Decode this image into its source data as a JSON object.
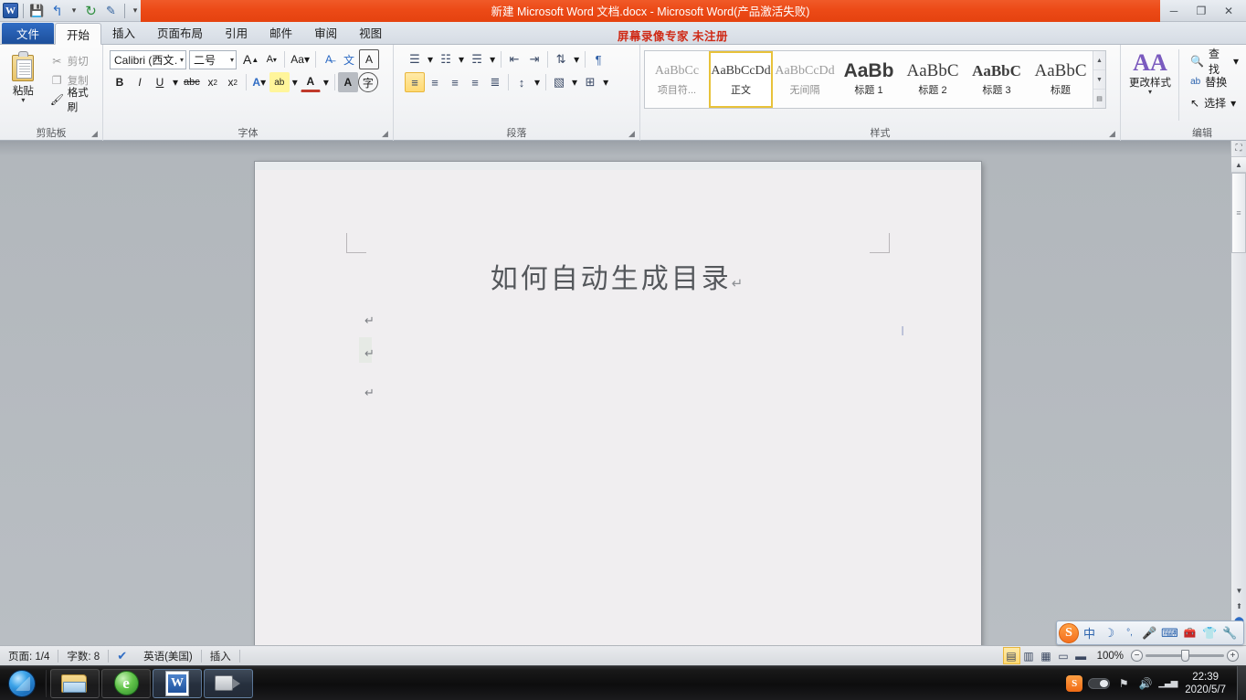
{
  "window": {
    "title": "新建 Microsoft Word 文档.docx - Microsoft Word(产品激活失败)",
    "minimize": "─",
    "restore": "❐",
    "close": "✕",
    "accent_color": "#ec4a17"
  },
  "qat": {
    "logo": "W",
    "save": "💾",
    "undo": "↰",
    "undo_caret": "▾",
    "redo": "↻",
    "touch": "✎",
    "more": "▾"
  },
  "tabs": [
    {
      "label": "文件",
      "kind": "file"
    },
    {
      "label": "开始",
      "kind": "active"
    },
    {
      "label": "插入",
      "kind": "normal"
    },
    {
      "label": "页面布局",
      "kind": "normal"
    },
    {
      "label": "引用",
      "kind": "normal"
    },
    {
      "label": "邮件",
      "kind": "normal"
    },
    {
      "label": "审阅",
      "kind": "normal"
    },
    {
      "label": "视图",
      "kind": "normal"
    }
  ],
  "recorder_note": "屏幕录像专家  未注册",
  "ribbon": {
    "clipboard": {
      "group_label": "剪贴板",
      "paste_label": "粘贴",
      "paste_caret": "▾",
      "items": [
        {
          "label": "剪切",
          "icon": "✂"
        },
        {
          "label": "复制",
          "icon": "❐"
        },
        {
          "label": "格式刷",
          "icon": "🖌"
        }
      ],
      "dialog_launcher": "◢"
    },
    "font": {
      "group_label": "字体",
      "font_name": "Calibri (西文…",
      "font_size": "二号",
      "grow_font": "A",
      "shrink_font": "A",
      "change_case": "Aa",
      "clear_format": "A̶",
      "phonetic": "文",
      "char_border": "A",
      "bold": "B",
      "italic": "I",
      "underline": "U",
      "strikethrough": "abc",
      "subscript": "x",
      "superscript": "x",
      "text_effects": "A",
      "highlight": "ab",
      "font_color": "A",
      "shading_char": "A",
      "enclose_char": "字",
      "dialog_launcher": "◢"
    },
    "paragraph": {
      "group_label": "段落",
      "bullets": "☰",
      "numbering": "☷",
      "multilevel": "☴",
      "decrease_indent": "⇤",
      "increase_indent": "⇥",
      "sort": "⇅",
      "show_marks": "¶",
      "align_left": "≡",
      "align_center": "≡",
      "align_right": "≡",
      "justify": "≡",
      "distributed": "≣",
      "line_spacing": "↕",
      "shading": "▧",
      "borders": "⊞",
      "dialog_launcher": "◢"
    },
    "styles": {
      "group_label": "样式",
      "items": [
        {
          "preview": "AaBbCc",
          "name": "项目符...",
          "selected": false,
          "variant": "gray"
        },
        {
          "preview": "AaBbCcDd",
          "name": "正文",
          "selected": true,
          "variant": "normal"
        },
        {
          "preview": "AaBbCcDd",
          "name": "无间隔",
          "selected": false,
          "variant": "gray"
        },
        {
          "preview": "AaBb",
          "name": "标题 1",
          "selected": false,
          "variant": "big"
        },
        {
          "preview": "AaBbC",
          "name": "标题 2",
          "selected": false,
          "variant": "serif"
        },
        {
          "preview": "AaBbC",
          "name": "标题 3",
          "selected": false,
          "variant": "bold3"
        },
        {
          "preview": "AaBbC",
          "name": "标题",
          "selected": false,
          "variant": "serif"
        }
      ],
      "scroll_up": "▲",
      "scroll_down": "▼",
      "more": "▤",
      "dialog_launcher": "◢"
    },
    "editing": {
      "group_label": "编辑",
      "change_styles_label": "更改样式",
      "change_styles_icon": "AA",
      "change_styles_caret": "▾",
      "items": [
        {
          "label": "查找",
          "icon": "🔍",
          "caret": "▾"
        },
        {
          "label": "替换",
          "icon": "ab",
          "caret": ""
        },
        {
          "label": "选择",
          "icon": "↖",
          "caret": "▾"
        }
      ]
    }
  },
  "document": {
    "title_text": "如何自动生成目录",
    "pilcrow": "↵",
    "paragraph_marks": [
      "↵",
      "↵",
      "↵"
    ],
    "page_bg": "#f0eef0",
    "caret": "I"
  },
  "scrollbar": {
    "up_arrow": "▲",
    "down_arrow": "▼",
    "thumb_grip": "≡",
    "prev_page": "⬆",
    "browse_object": "⬤",
    "next_page": "⬇",
    "top_icon": "⛶"
  },
  "statusbar": {
    "page": "页面: 1/4",
    "words": "字数: 8",
    "proofing_icon": "✔",
    "language": "英语(美国)",
    "insert_mode": "插入",
    "views": [
      {
        "name": "print-layout",
        "glyph": "▤",
        "active": true
      },
      {
        "name": "full-screen-reading",
        "glyph": "▥",
        "active": false
      },
      {
        "name": "web-layout",
        "glyph": "▦",
        "active": false
      },
      {
        "name": "outline",
        "glyph": "▭",
        "active": false
      },
      {
        "name": "draft",
        "glyph": "▬",
        "active": false
      }
    ],
    "zoom_value": "100%",
    "zoom_out": "−",
    "zoom_in": "+"
  },
  "ime": {
    "logo": "S",
    "buttons": [
      {
        "name": "chinese-mode",
        "glyph": "中"
      },
      {
        "name": "moon-icon",
        "glyph": "☽"
      },
      {
        "name": "punctuation-icon",
        "glyph": "°,"
      },
      {
        "name": "microphone-icon",
        "glyph": "🎤"
      },
      {
        "name": "keyboard-icon",
        "glyph": "⌨"
      },
      {
        "name": "toolbox-icon",
        "glyph": "🧰"
      },
      {
        "name": "skin-icon",
        "glyph": "👕"
      },
      {
        "name": "settings-icon",
        "glyph": "🔧"
      }
    ]
  },
  "taskbar": {
    "start_tooltip": "开始",
    "buttons": [
      {
        "name": "explorer",
        "state": "pinned"
      },
      {
        "name": "browser",
        "state": "pinned"
      },
      {
        "name": "word",
        "state": "active"
      },
      {
        "name": "screen-recorder",
        "state": "active"
      }
    ],
    "tray": {
      "sogou": "S",
      "network_bars": "▁▃▅",
      "speaker": "🔊",
      "action_center": "⚑"
    },
    "time": "22:39",
    "date": "2020/5/7"
  }
}
